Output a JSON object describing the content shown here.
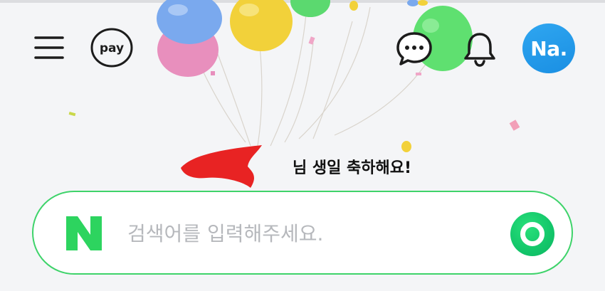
{
  "header": {
    "pay_label": "pay",
    "avatar_initials": "Na."
  },
  "greeting": {
    "text": "님 생일 축하해요!"
  },
  "search": {
    "logo_letter": "N",
    "placeholder": "검색어를 입력해주세요.",
    "value": ""
  },
  "colors": {
    "brand_green": "#03c75a",
    "avatar_blue": "#1a8fe3",
    "background": "#f4f5f7"
  },
  "icons": [
    "menu-icon",
    "pay-icon",
    "chat-icon",
    "bell-icon",
    "search-submit-icon"
  ]
}
